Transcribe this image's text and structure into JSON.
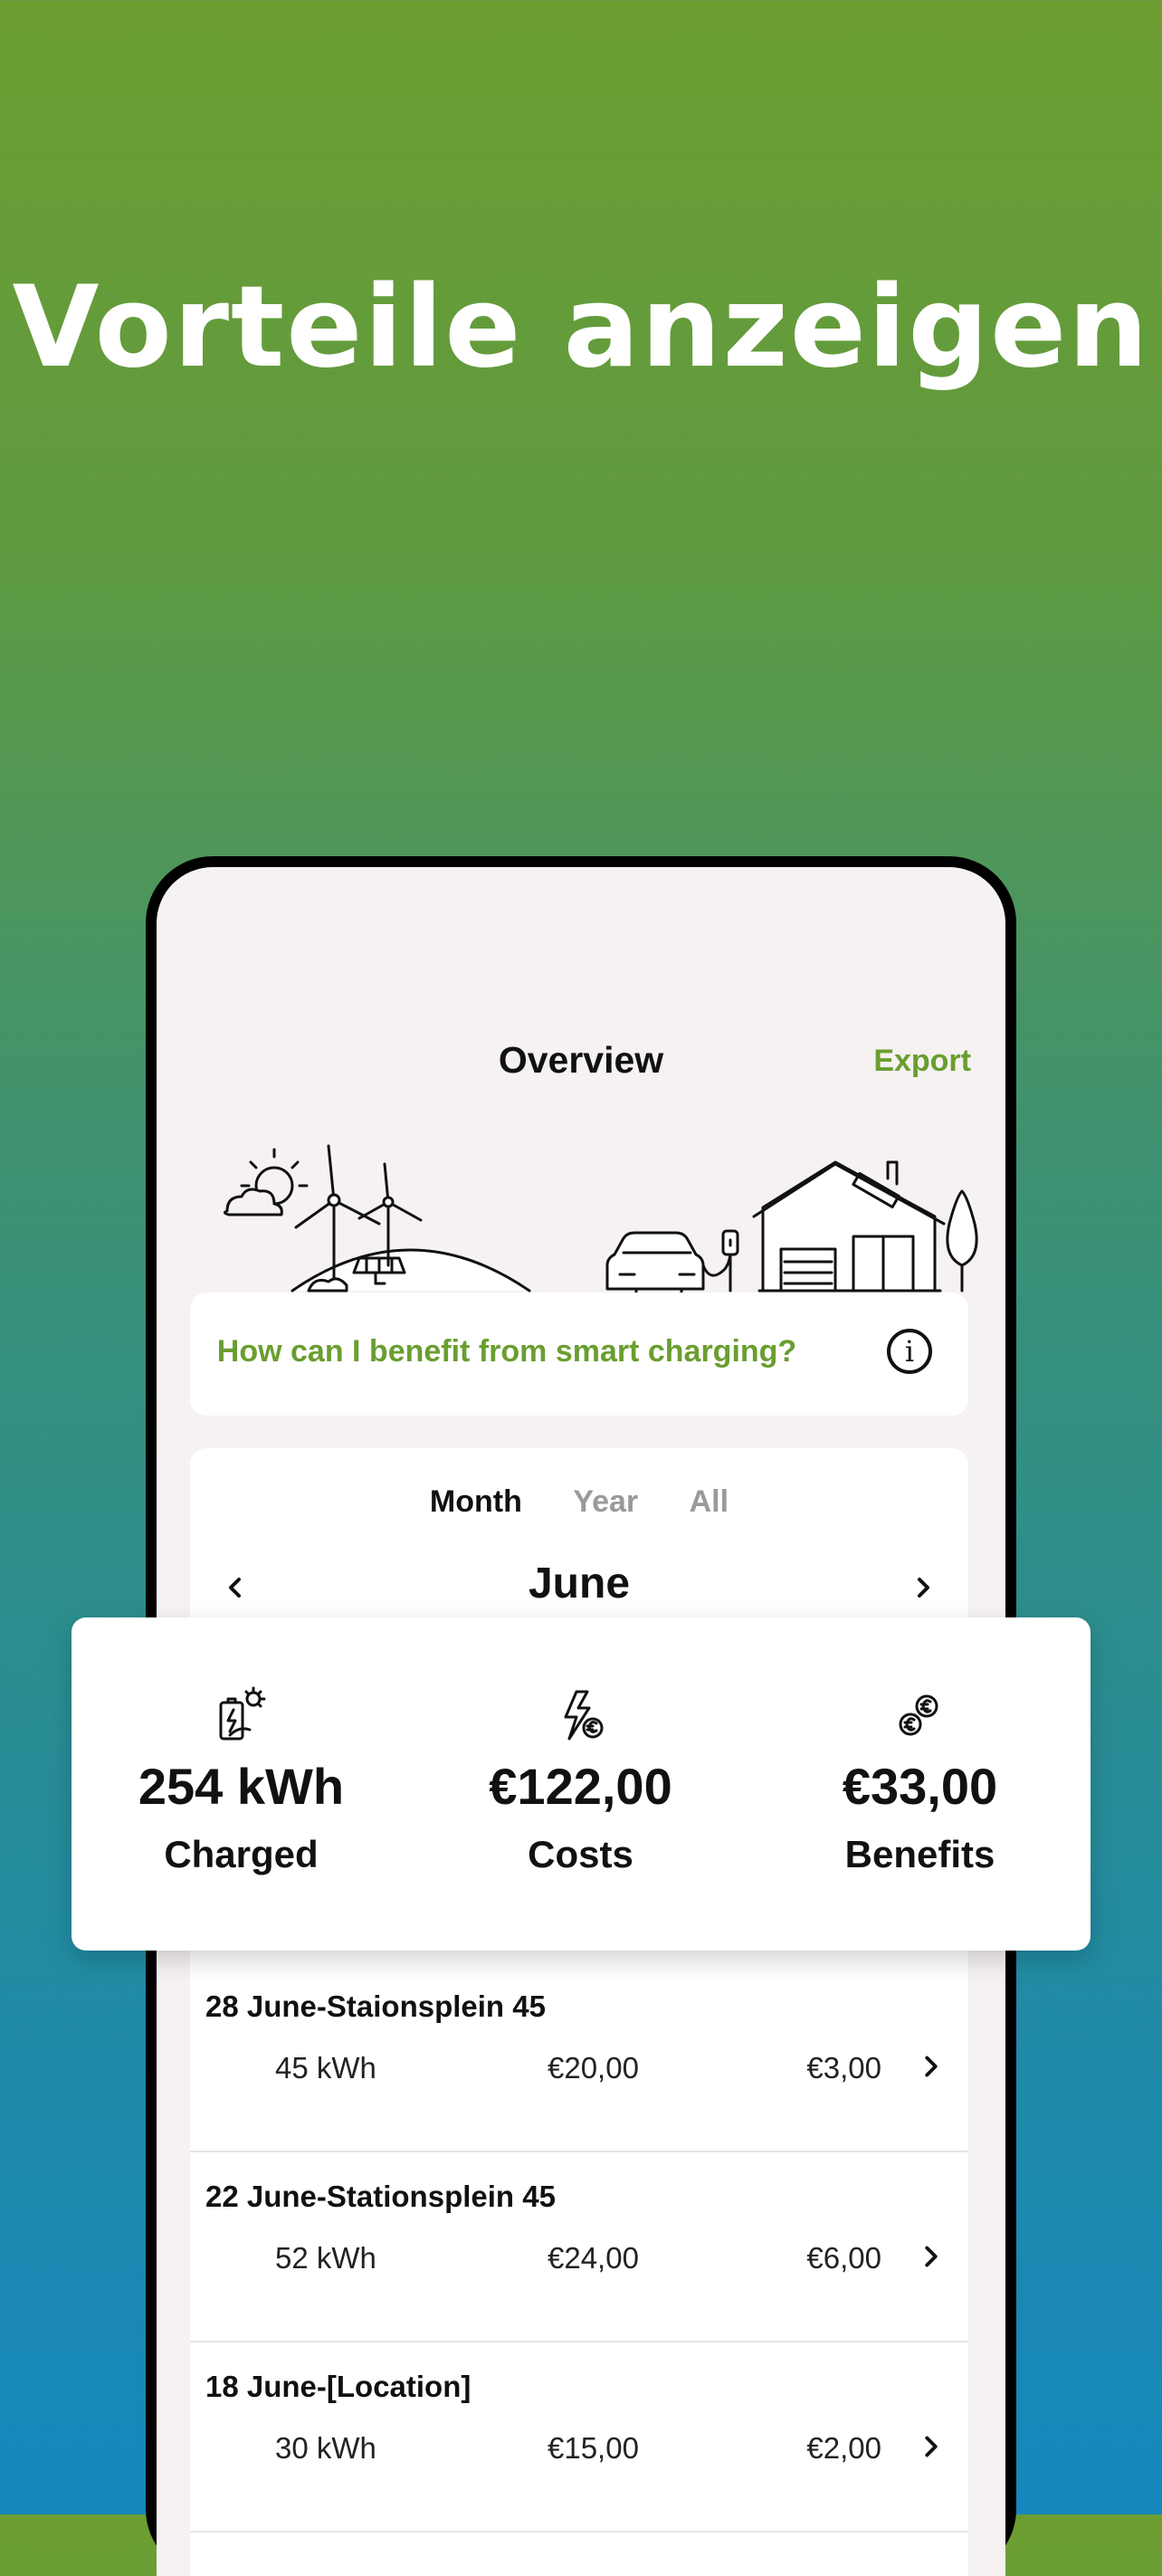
{
  "headline": "Vorteile anzeigen",
  "screen": {
    "title": "Overview",
    "export_label": "Export",
    "help_text": "How can I benefit from smart charging?",
    "tabs": [
      {
        "label": "Month",
        "active": true
      },
      {
        "label": "Year",
        "active": false
      },
      {
        "label": "All",
        "active": false
      }
    ],
    "month": "June"
  },
  "summary": {
    "charged": {
      "value": "254 kWh",
      "label": "Charged",
      "icon": "solar-battery-icon"
    },
    "costs": {
      "value": "€122,00",
      "label": "Costs",
      "icon": "bolt-euro-icon"
    },
    "benefits": {
      "value": "€33,00",
      "label": "Benefits",
      "icon": "coins-euro-icon"
    }
  },
  "sessions": [
    {
      "title": "28 June-Staionsplein 45",
      "kwh": "45 kWh",
      "cost": "€20,00",
      "benefit": "€3,00"
    },
    {
      "title": "22 June-Stationsplein 45",
      "kwh": "52 kWh",
      "cost": "€24,00",
      "benefit": "€6,00"
    },
    {
      "title": "18 June-[Location]",
      "kwh": "30 kWh",
      "cost": "€15,00",
      "benefit": "€2,00"
    }
  ],
  "colors": {
    "accent": "#6a9e30",
    "text": "#111111",
    "background_top": "#6c9e32",
    "background_bottom": "#1587bd"
  }
}
